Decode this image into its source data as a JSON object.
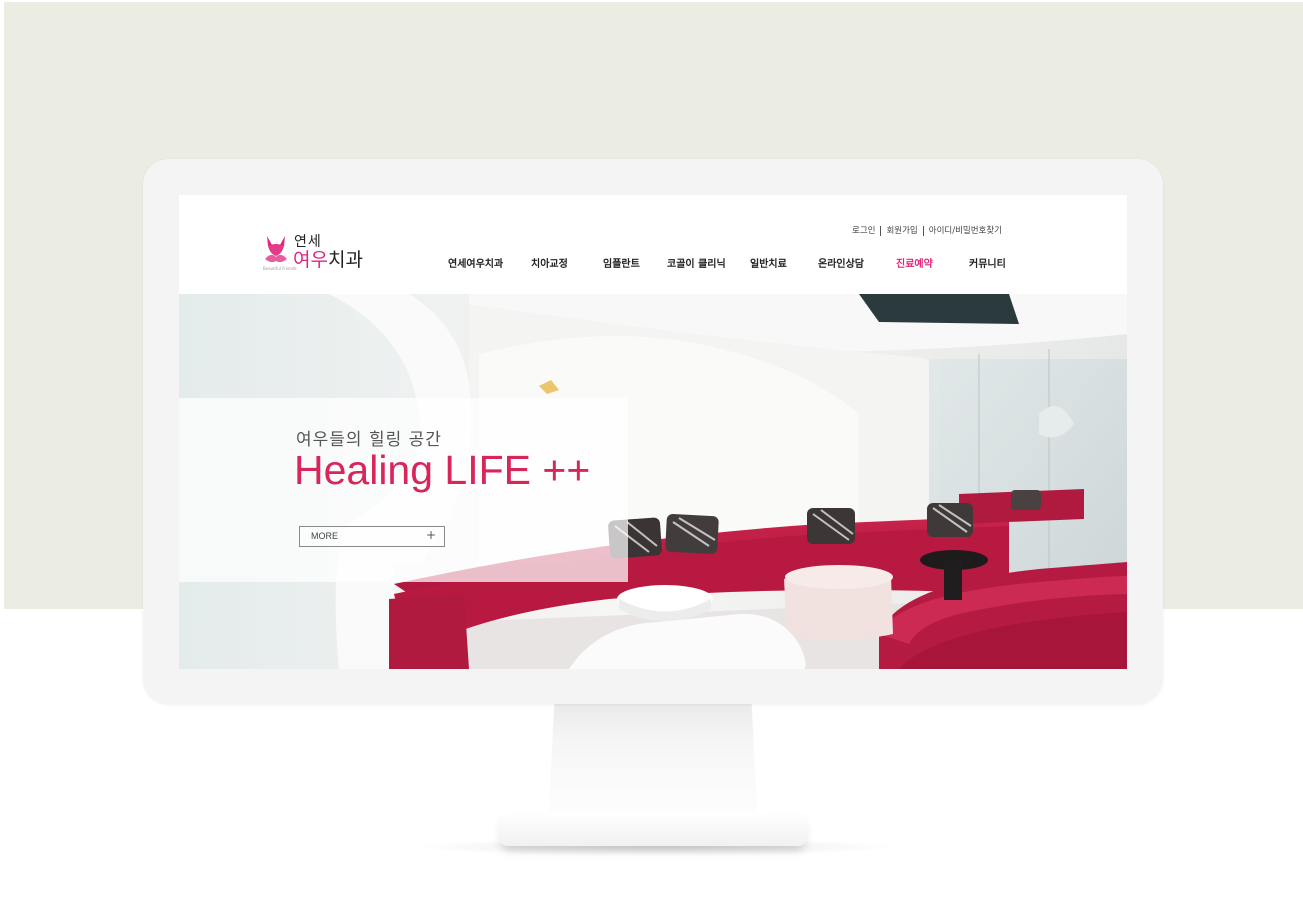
{
  "site": {
    "logo": {
      "top_text": "연세",
      "main_pink": "여우",
      "main_dark": "치과",
      "small_text": "Beautiful Friends"
    },
    "util_links": [
      "로그인",
      "회원가입",
      "아이디/비밀번호찾기"
    ],
    "nav": [
      {
        "label": "연세여우치과",
        "active": false
      },
      {
        "label": "치아교정",
        "active": false
      },
      {
        "label": "임플란트",
        "active": false
      },
      {
        "label": "코골이 클리닉",
        "active": false
      },
      {
        "label": "일반치료",
        "active": false
      },
      {
        "label": "온라인상담",
        "active": false
      },
      {
        "label": "진료예약",
        "active": true
      },
      {
        "label": "커뮤니티",
        "active": false
      }
    ],
    "hero": {
      "subtitle": "여우들의 힐링 공간",
      "title": "Healing LIFE ++",
      "button_label": "MORE",
      "button_icon": "+"
    }
  },
  "colors": {
    "accent": "#e0267c",
    "hero_title": "#d8255a",
    "sofa": "#b81940",
    "backdrop": "#ebede2"
  }
}
